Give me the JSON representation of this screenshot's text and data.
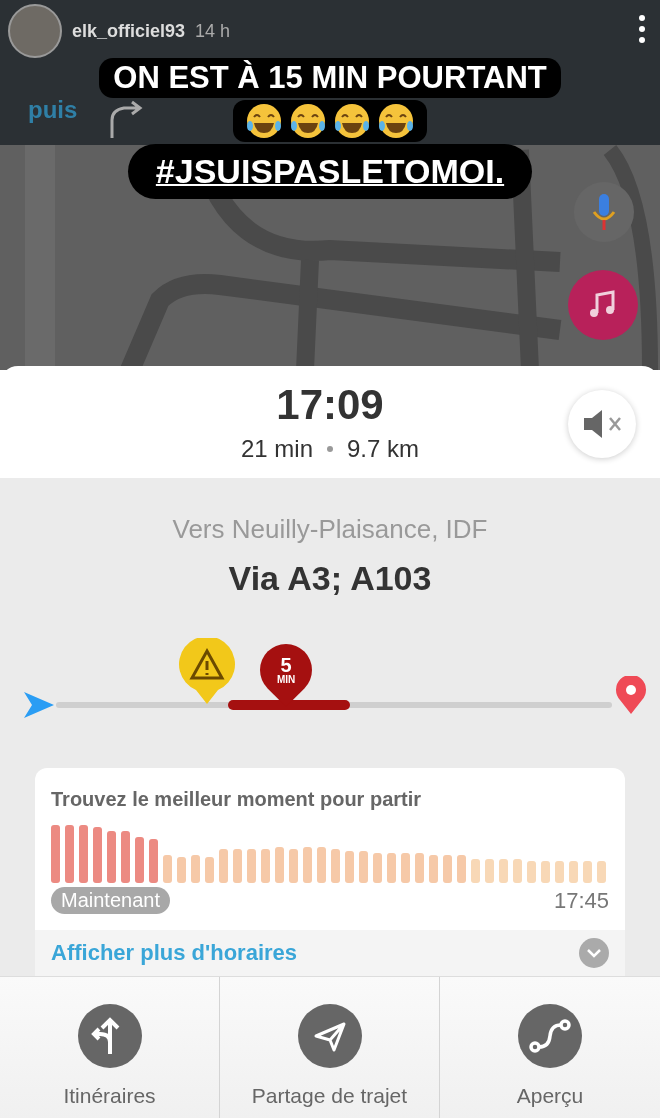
{
  "story": {
    "username": "elk_officiel93",
    "time": "14 h"
  },
  "caption": {
    "lines": [
      "ON EST À 15 MIN POURTANT"
    ],
    "hashtag": "#JSUISPASLETOMOI."
  },
  "navigation": {
    "next_label": "puis"
  },
  "trip": {
    "arrival": "17:09",
    "duration": "21 min",
    "distance": "9.7 km",
    "muted": true
  },
  "route": {
    "destination": "Vers Neuilly-Plaisance, IDF",
    "via": "Via A3; A103",
    "jam": {
      "value": "5",
      "unit": "MIN"
    }
  },
  "departure": {
    "title": "Trouvez le meilleur moment pour partir",
    "start_label": "Maintenant",
    "end_label": "17:45",
    "more_link": "Afficher plus d'horaires"
  },
  "actions": [
    {
      "kind": "routes",
      "label": "Itinéraires"
    },
    {
      "kind": "share",
      "label": "Partage de trajet"
    },
    {
      "kind": "overview",
      "label": "Aperçu"
    }
  ]
}
